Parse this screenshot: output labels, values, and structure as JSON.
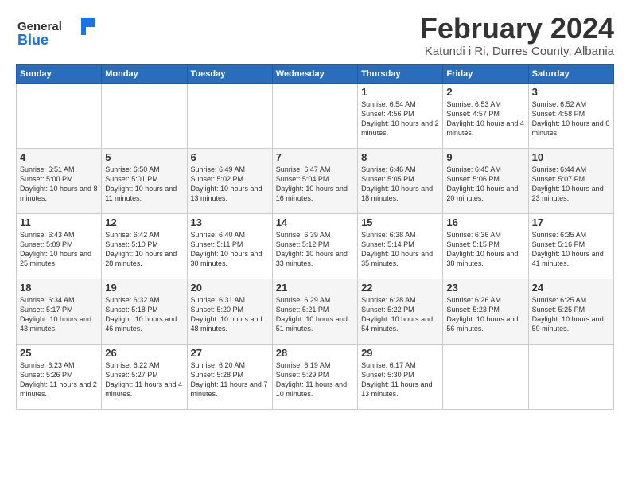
{
  "header": {
    "logo_general": "General",
    "logo_blue": "Blue",
    "month_title": "February 2024",
    "location": "Katundi i Ri, Durres County, Albania"
  },
  "calendar": {
    "days_of_week": [
      "Sunday",
      "Monday",
      "Tuesday",
      "Wednesday",
      "Thursday",
      "Friday",
      "Saturday"
    ],
    "weeks": [
      [
        {
          "day": "",
          "info": ""
        },
        {
          "day": "",
          "info": ""
        },
        {
          "day": "",
          "info": ""
        },
        {
          "day": "",
          "info": ""
        },
        {
          "day": "1",
          "info": "Sunrise: 6:54 AM\nSunset: 4:56 PM\nDaylight: 10 hours\nand 2 minutes."
        },
        {
          "day": "2",
          "info": "Sunrise: 6:53 AM\nSunset: 4:57 PM\nDaylight: 10 hours\nand 4 minutes."
        },
        {
          "day": "3",
          "info": "Sunrise: 6:52 AM\nSunset: 4:58 PM\nDaylight: 10 hours\nand 6 minutes."
        }
      ],
      [
        {
          "day": "4",
          "info": "Sunrise: 6:51 AM\nSunset: 5:00 PM\nDaylight: 10 hours\nand 8 minutes."
        },
        {
          "day": "5",
          "info": "Sunrise: 6:50 AM\nSunset: 5:01 PM\nDaylight: 10 hours\nand 11 minutes."
        },
        {
          "day": "6",
          "info": "Sunrise: 6:49 AM\nSunset: 5:02 PM\nDaylight: 10 hours\nand 13 minutes."
        },
        {
          "day": "7",
          "info": "Sunrise: 6:47 AM\nSunset: 5:04 PM\nDaylight: 10 hours\nand 16 minutes."
        },
        {
          "day": "8",
          "info": "Sunrise: 6:46 AM\nSunset: 5:05 PM\nDaylight: 10 hours\nand 18 minutes."
        },
        {
          "day": "9",
          "info": "Sunrise: 6:45 AM\nSunset: 5:06 PM\nDaylight: 10 hours\nand 20 minutes."
        },
        {
          "day": "10",
          "info": "Sunrise: 6:44 AM\nSunset: 5:07 PM\nDaylight: 10 hours\nand 23 minutes."
        }
      ],
      [
        {
          "day": "11",
          "info": "Sunrise: 6:43 AM\nSunset: 5:09 PM\nDaylight: 10 hours\nand 25 minutes."
        },
        {
          "day": "12",
          "info": "Sunrise: 6:42 AM\nSunset: 5:10 PM\nDaylight: 10 hours\nand 28 minutes."
        },
        {
          "day": "13",
          "info": "Sunrise: 6:40 AM\nSunset: 5:11 PM\nDaylight: 10 hours\nand 30 minutes."
        },
        {
          "day": "14",
          "info": "Sunrise: 6:39 AM\nSunset: 5:12 PM\nDaylight: 10 hours\nand 33 minutes."
        },
        {
          "day": "15",
          "info": "Sunrise: 6:38 AM\nSunset: 5:14 PM\nDaylight: 10 hours\nand 35 minutes."
        },
        {
          "day": "16",
          "info": "Sunrise: 6:36 AM\nSunset: 5:15 PM\nDaylight: 10 hours\nand 38 minutes."
        },
        {
          "day": "17",
          "info": "Sunrise: 6:35 AM\nSunset: 5:16 PM\nDaylight: 10 hours\nand 41 minutes."
        }
      ],
      [
        {
          "day": "18",
          "info": "Sunrise: 6:34 AM\nSunset: 5:17 PM\nDaylight: 10 hours\nand 43 minutes."
        },
        {
          "day": "19",
          "info": "Sunrise: 6:32 AM\nSunset: 5:18 PM\nDaylight: 10 hours\nand 46 minutes."
        },
        {
          "day": "20",
          "info": "Sunrise: 6:31 AM\nSunset: 5:20 PM\nDaylight: 10 hours\nand 48 minutes."
        },
        {
          "day": "21",
          "info": "Sunrise: 6:29 AM\nSunset: 5:21 PM\nDaylight: 10 hours\nand 51 minutes."
        },
        {
          "day": "22",
          "info": "Sunrise: 6:28 AM\nSunset: 5:22 PM\nDaylight: 10 hours\nand 54 minutes."
        },
        {
          "day": "23",
          "info": "Sunrise: 6:26 AM\nSunset: 5:23 PM\nDaylight: 10 hours\nand 56 minutes."
        },
        {
          "day": "24",
          "info": "Sunrise: 6:25 AM\nSunset: 5:25 PM\nDaylight: 10 hours\nand 59 minutes."
        }
      ],
      [
        {
          "day": "25",
          "info": "Sunrise: 6:23 AM\nSunset: 5:26 PM\nDaylight: 11 hours\nand 2 minutes."
        },
        {
          "day": "26",
          "info": "Sunrise: 6:22 AM\nSunset: 5:27 PM\nDaylight: 11 hours\nand 4 minutes."
        },
        {
          "day": "27",
          "info": "Sunrise: 6:20 AM\nSunset: 5:28 PM\nDaylight: 11 hours\nand 7 minutes."
        },
        {
          "day": "28",
          "info": "Sunrise: 6:19 AM\nSunset: 5:29 PM\nDaylight: 11 hours\nand 10 minutes."
        },
        {
          "day": "29",
          "info": "Sunrise: 6:17 AM\nSunset: 5:30 PM\nDaylight: 11 hours\nand 13 minutes."
        },
        {
          "day": "",
          "info": ""
        },
        {
          "day": "",
          "info": ""
        }
      ]
    ]
  }
}
